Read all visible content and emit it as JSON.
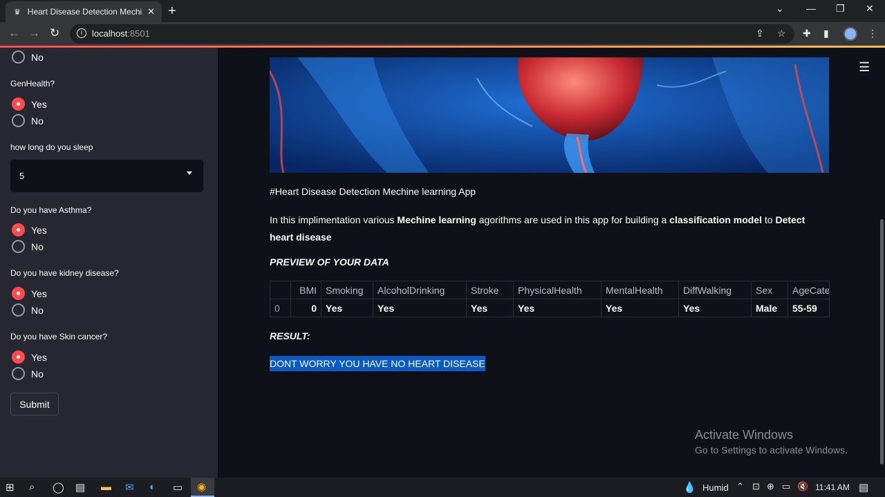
{
  "browser": {
    "tab_title": "Heart Disease Detection Mechine",
    "url_host": "localhost",
    "url_port": ":8501"
  },
  "sidebar": {
    "top_no": "No",
    "gen_health": {
      "label": "GenHealth?",
      "yes": "Yes",
      "no": "No",
      "selected": "Yes"
    },
    "sleep": {
      "label": "how long do you sleep",
      "value": "5"
    },
    "asthma": {
      "label": "Do you have Asthma?",
      "yes": "Yes",
      "no": "No",
      "selected": "Yes"
    },
    "kidney": {
      "label": "Do you have kidney disease?",
      "yes": "Yes",
      "no": "No",
      "selected": "Yes"
    },
    "skin_cancer": {
      "label": "Do you have Skin cancer?",
      "yes": "Yes",
      "no": "No",
      "selected": "Yes"
    },
    "submit_label": "Submit"
  },
  "main": {
    "app_title": "#Heart Disease Detection Mechine learning App",
    "desc": {
      "p1": "In this implimentation various ",
      "b1": "Mechine learning",
      "p2": " agorithms are used in this app for building a ",
      "b2": "classification model",
      "p3": " to ",
      "b3": "Detect heart disease"
    },
    "preview_heading": "PREVIEW OF YOUR DATA",
    "table": {
      "headers": [
        "",
        "BMI",
        "Smoking",
        "AlcoholDrinking",
        "Stroke",
        "PhysicalHealth",
        "MentalHealth",
        "DiffWalking",
        "Sex",
        "AgeCategory"
      ],
      "row": [
        "0",
        "0",
        "Yes",
        "Yes",
        "Yes",
        "Yes",
        "Yes",
        "Yes",
        "Male",
        "55-59"
      ]
    },
    "result_heading": "RESULT:",
    "result_text": "DONT WORRY YOU HAVE NO HEART DISEASE",
    "watermark_title": "Activate Windows",
    "watermark_sub": "Go to Settings to activate Windows."
  },
  "taskbar": {
    "weather": "Humid",
    "time": "11:41 AM"
  }
}
